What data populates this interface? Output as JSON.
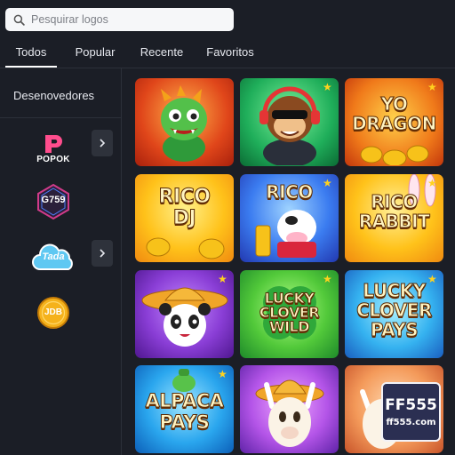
{
  "search": {
    "placeholder": "Pesquirar logos",
    "icon": "search-icon"
  },
  "tabs": [
    {
      "label": "Todos",
      "active": true
    },
    {
      "label": "Popular",
      "active": false
    },
    {
      "label": "Recente",
      "active": false
    },
    {
      "label": "Favoritos",
      "active": false
    }
  ],
  "sidebar": {
    "title": "Desenovedores",
    "providers": [
      {
        "name": "POPOK",
        "logo_text": "POPOK",
        "has_chevron": true
      },
      {
        "name": "G759",
        "logo_text": "G759",
        "has_chevron": false
      },
      {
        "name": "Tada",
        "logo_text": "Tada",
        "has_chevron": true
      },
      {
        "name": "JDB",
        "logo_text": "JDB",
        "has_chevron": false
      }
    ]
  },
  "games": [
    {
      "id": "dragon",
      "title": "",
      "bg": [
        "#f1791a",
        "#c0280f"
      ],
      "starred": false
    },
    {
      "id": "monkey",
      "title": "",
      "bg": [
        "#29c46a",
        "#0b7a3a"
      ],
      "starred": true
    },
    {
      "id": "yo-dragon",
      "title": "YO DRAGON",
      "bg": [
        "#ff9a1f",
        "#d2410b"
      ],
      "starred": true
    },
    {
      "id": "rico-dj",
      "title": "RICO DJ",
      "bg": [
        "#ffd04a",
        "#f29a10"
      ],
      "starred": false
    },
    {
      "id": "rico",
      "title": "RICO",
      "bg": [
        "#6aa8ff",
        "#2948c9"
      ],
      "starred": true
    },
    {
      "id": "rico-rabbit",
      "title": "RICO RABBIT",
      "bg": [
        "#ffd24a",
        "#f08a10"
      ],
      "starred": true
    },
    {
      "id": "panda",
      "title": "",
      "bg": [
        "#9d4fd9",
        "#5b1f9a"
      ],
      "starred": true
    },
    {
      "id": "lucky-clover-wild",
      "title": "LUCKY CLOVER WILD",
      "bg": [
        "#7fe05a",
        "#2a9a2a"
      ],
      "starred": true
    },
    {
      "id": "lucky-clover-pays",
      "title": "LUCKY CLOVER PAYS",
      "bg": [
        "#3fc8ff",
        "#1c6fd0"
      ],
      "starred": true
    },
    {
      "id": "alpaca-pays",
      "title": "ALPACA PAYS",
      "bg": [
        "#2bb5ff",
        "#0e6cc7"
      ],
      "starred": true
    },
    {
      "id": "alpaca",
      "title": "",
      "bg": [
        "#c55bf0",
        "#6c2ab0"
      ],
      "starred": false
    },
    {
      "id": "alpaca-2",
      "title": "",
      "bg": [
        "#ffb17a",
        "#e06a2a"
      ],
      "starred": false
    }
  ],
  "watermark": {
    "big": "FF555",
    "small": "ff555.com"
  }
}
